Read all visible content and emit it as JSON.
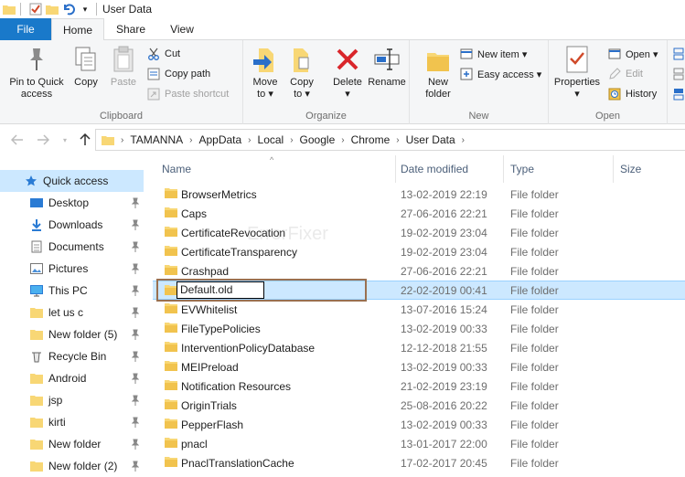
{
  "window": {
    "title": "User Data"
  },
  "tabs": {
    "file": "File",
    "home": "Home",
    "share": "Share",
    "view": "View"
  },
  "ribbon": {
    "clipboard": {
      "label": "Clipboard",
      "pin": "Pin to Quick access",
      "pin_line1": "Pin to Quick",
      "pin_line2": "access",
      "copy": "Copy",
      "paste": "Paste",
      "cut": "Cut",
      "copy_path": "Copy path",
      "paste_shortcut": "Paste shortcut"
    },
    "organize": {
      "label": "Organize",
      "move_line1": "Move",
      "move_line2": "to",
      "copy_line1": "Copy",
      "copy_line2": "to",
      "delete": "Delete",
      "rename": "Rename"
    },
    "new": {
      "label": "New",
      "folder_line1": "New",
      "folder_line2": "folder",
      "new_item": "New item",
      "easy_access": "Easy access"
    },
    "open": {
      "label": "Open",
      "properties": "Properties",
      "open": "Open",
      "edit": "Edit",
      "history": "History"
    }
  },
  "address": {
    "crumbs": [
      "TAMANNA",
      "AppData",
      "Local",
      "Google",
      "Chrome",
      "User Data"
    ]
  },
  "nav": {
    "quick_access": "Quick access",
    "items": [
      "Desktop",
      "Downloads",
      "Documents",
      "Pictures",
      "This PC",
      "let us c",
      "New folder (5)",
      "Recycle Bin",
      "Android",
      "jsp",
      "kirti",
      "New folder",
      "New folder (2)"
    ]
  },
  "columns": {
    "name": "Name",
    "date": "Date modified",
    "type": "Type",
    "size": "Size"
  },
  "files": [
    {
      "name": "BrowserMetrics",
      "date": "13-02-2019 22:19",
      "type": "File folder"
    },
    {
      "name": "Caps",
      "date": "27-06-2016 22:21",
      "type": "File folder"
    },
    {
      "name": "CertificateRevocation",
      "date": "19-02-2019 23:04",
      "type": "File folder"
    },
    {
      "name": "CertificateTransparency",
      "date": "19-02-2019 23:04",
      "type": "File folder"
    },
    {
      "name": "Crashpad",
      "date": "27-06-2016 22:21",
      "type": "File folder"
    },
    {
      "name": "Default.old",
      "date": "22-02-2019 00:41",
      "type": "File folder"
    },
    {
      "name": "EVWhitelist",
      "date": "13-07-2016 15:24",
      "type": "File folder"
    },
    {
      "name": "FileTypePolicies",
      "date": "13-02-2019 00:33",
      "type": "File folder"
    },
    {
      "name": "InterventionPolicyDatabase",
      "date": "12-12-2018 21:55",
      "type": "File folder"
    },
    {
      "name": "MEIPreload",
      "date": "13-02-2019 00:33",
      "type": "File folder"
    },
    {
      "name": "Notification Resources",
      "date": "21-02-2019 23:19",
      "type": "File folder"
    },
    {
      "name": "OriginTrials",
      "date": "25-08-2016 20:22",
      "type": "File folder"
    },
    {
      "name": "PepperFlash",
      "date": "13-02-2019 00:33",
      "type": "File folder"
    },
    {
      "name": "pnacl",
      "date": "13-01-2017 22:00",
      "type": "File folder"
    },
    {
      "name": "PnaclTranslationCache",
      "date": "17-02-2017 20:45",
      "type": "File folder"
    }
  ],
  "watermark": "ErrorFixer",
  "colors": {
    "file_tab": "#1979ca",
    "selection": "#cce8ff",
    "folder": "#f8d775",
    "delete_red": "#d9262b",
    "frame": "#9a7050"
  }
}
